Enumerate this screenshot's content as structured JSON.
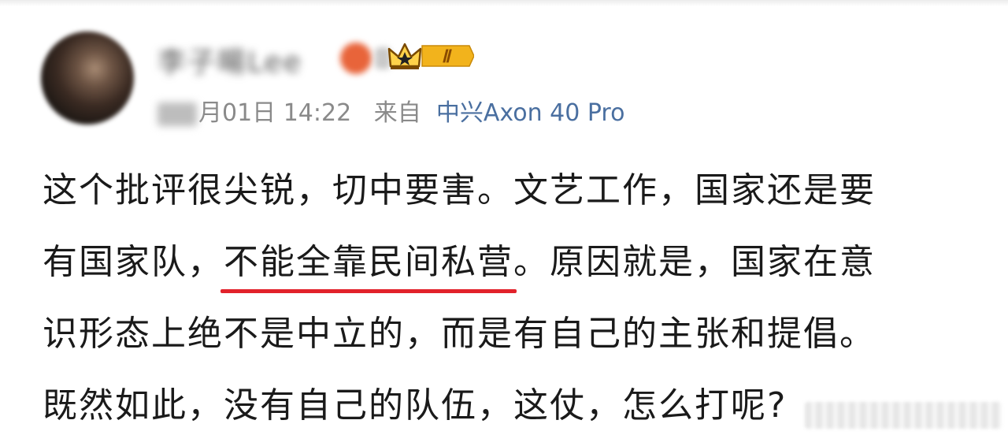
{
  "post": {
    "author_name": "李子暘Lee",
    "timestamp": "月01日 14:22",
    "source_prefix": "来自",
    "device": "中兴Axon 40 Pro",
    "badge_label": "Ⅱ",
    "lines": [
      "这个批评很尖锐，切中要害。文艺工作，国家还是要",
      "有国家队，",
      "。原因就是，国家在意",
      "识形态上绝不是中立的，而是有自己的主张和提倡。",
      "既然如此，没有自己的队伍，这仗，怎么打呢?"
    ],
    "highlighted_text": "不能全靠民间私营"
  },
  "colors": {
    "accent_link": "#4a6fa0",
    "underline": "#e2222b",
    "badge_gold": "#f2b31c"
  }
}
